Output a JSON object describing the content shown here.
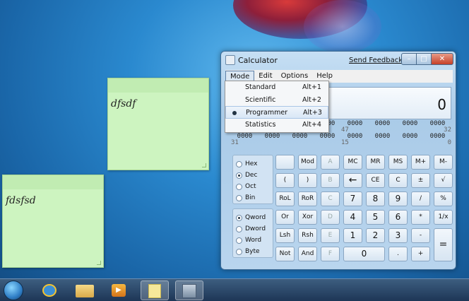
{
  "notes": [
    {
      "text": "dfsdf"
    },
    {
      "text": "fdsfsd"
    }
  ],
  "window": {
    "title": "Calculator",
    "feedback": "Send Feedback",
    "min": "–",
    "max": "□",
    "close": "✕"
  },
  "menu": {
    "mode": "Mode",
    "edit": "Edit",
    "options": "Options",
    "help": "Help"
  },
  "dropdown": [
    {
      "label": "Standard",
      "key": "Alt+1"
    },
    {
      "label": "Scientific",
      "key": "Alt+2"
    },
    {
      "label": "Programmer",
      "key": "Alt+3"
    },
    {
      "label": "Statistics",
      "key": "Alt+4"
    }
  ],
  "display": {
    "value": "0"
  },
  "bits": {
    "row1": [
      "0000",
      "0000",
      "0000",
      "0000",
      "0000",
      "0000",
      "0000",
      "0000"
    ],
    "row1_labels": [
      "",
      "",
      "",
      "",
      "47",
      "",
      "",
      "32"
    ],
    "row2": [
      "0000",
      "0000",
      "0000",
      "0000",
      "0000",
      "0000",
      "0000",
      "0000"
    ],
    "row2_labels": [
      "31",
      "",
      "",
      "",
      "15",
      "",
      "",
      "0"
    ]
  },
  "base_radios": [
    "Hex",
    "Dec",
    "Oct",
    "Bin"
  ],
  "word_radios": [
    "Qword",
    "Dword",
    "Word",
    "Byte"
  ],
  "buttons": {
    "r1": [
      "",
      "Mod",
      "A",
      "MC",
      "MR",
      "MS",
      "M+",
      "M-"
    ],
    "r2": [
      "(",
      ")",
      "B",
      "←",
      "CE",
      "C",
      "±",
      "√"
    ],
    "r3": [
      "RoL",
      "RoR",
      "C",
      "7",
      "8",
      "9",
      "/",
      "%"
    ],
    "r4": [
      "Or",
      "Xor",
      "D",
      "4",
      "5",
      "6",
      "*",
      "1/x"
    ],
    "r5": [
      "Lsh",
      "Rsh",
      "E",
      "1",
      "2",
      "3",
      "-",
      "="
    ],
    "r6": [
      "Not",
      "And",
      "F",
      "0",
      ".",
      "+"
    ]
  },
  "taskbar": {
    "media_glyph": "▶"
  }
}
